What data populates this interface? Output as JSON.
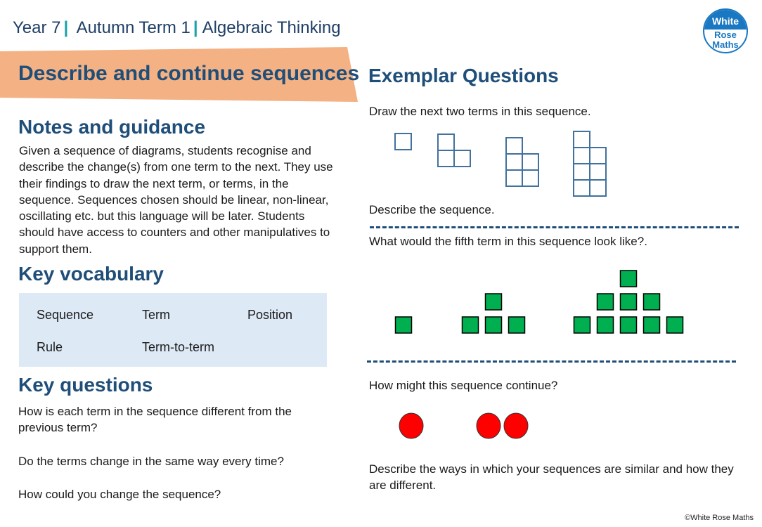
{
  "header": {
    "breadcrumb": [
      {
        "label": "Year 7"
      },
      {
        "label": "Autumn Term 1"
      },
      {
        "label": "Algebraic Thinking"
      }
    ],
    "banner_title": "Describe and continue sequences",
    "banner_color": "#f4b183",
    "logo": {
      "line1": "White",
      "line2": "Rose",
      "line3": "Maths",
      "color": "#1a78c2"
    }
  },
  "left": {
    "notes_heading": "Notes and guidance",
    "notes_text": "Given a sequence of diagrams, students recognise and describe the change(s) from one term to the next.  They use their findings to draw the next term, or terms, in the sequence.  Sequences chosen should be linear, non-linear, oscillating etc. but this language will be later. Students should have access to counters and other manipulatives to support them.",
    "vocab_heading": "Key vocabulary",
    "vocab": [
      "Sequence",
      "Term",
      "Position",
      "Rule",
      "Term-to-term"
    ],
    "questions_heading": "Key questions",
    "questions": [
      "How is each term in the sequence different from the previous term?",
      "Do the terms change in the same way every time?",
      "How could you change the sequence?"
    ]
  },
  "right": {
    "heading": "Exemplar Questions",
    "q1": "Draw the next two terms in this sequence.",
    "q1_sequence_terms": [
      {
        "columns": [
          1
        ]
      },
      {
        "columns": [
          2,
          1
        ]
      },
      {
        "columns": [
          3,
          2
        ]
      },
      {
        "columns": [
          4,
          3
        ]
      }
    ],
    "q2": "Describe the sequence.",
    "q3": "What would the fifth term in this sequence look like?.",
    "q3_sequence_terms": [
      {
        "rows": [
          1
        ]
      },
      {
        "rows": [
          3,
          1
        ]
      },
      {
        "rows": [
          5,
          3,
          1
        ]
      }
    ],
    "square_color": "#00b050",
    "q4": "How might this sequence continue?",
    "q4_sequence_terms": [
      1,
      2
    ],
    "circle_color": "#ff0000",
    "q5": "Describe the ways in which your sequences are similar and how they are different.",
    "outline_color": "#41719c"
  },
  "footer": {
    "copyright": "©White Rose Maths"
  }
}
